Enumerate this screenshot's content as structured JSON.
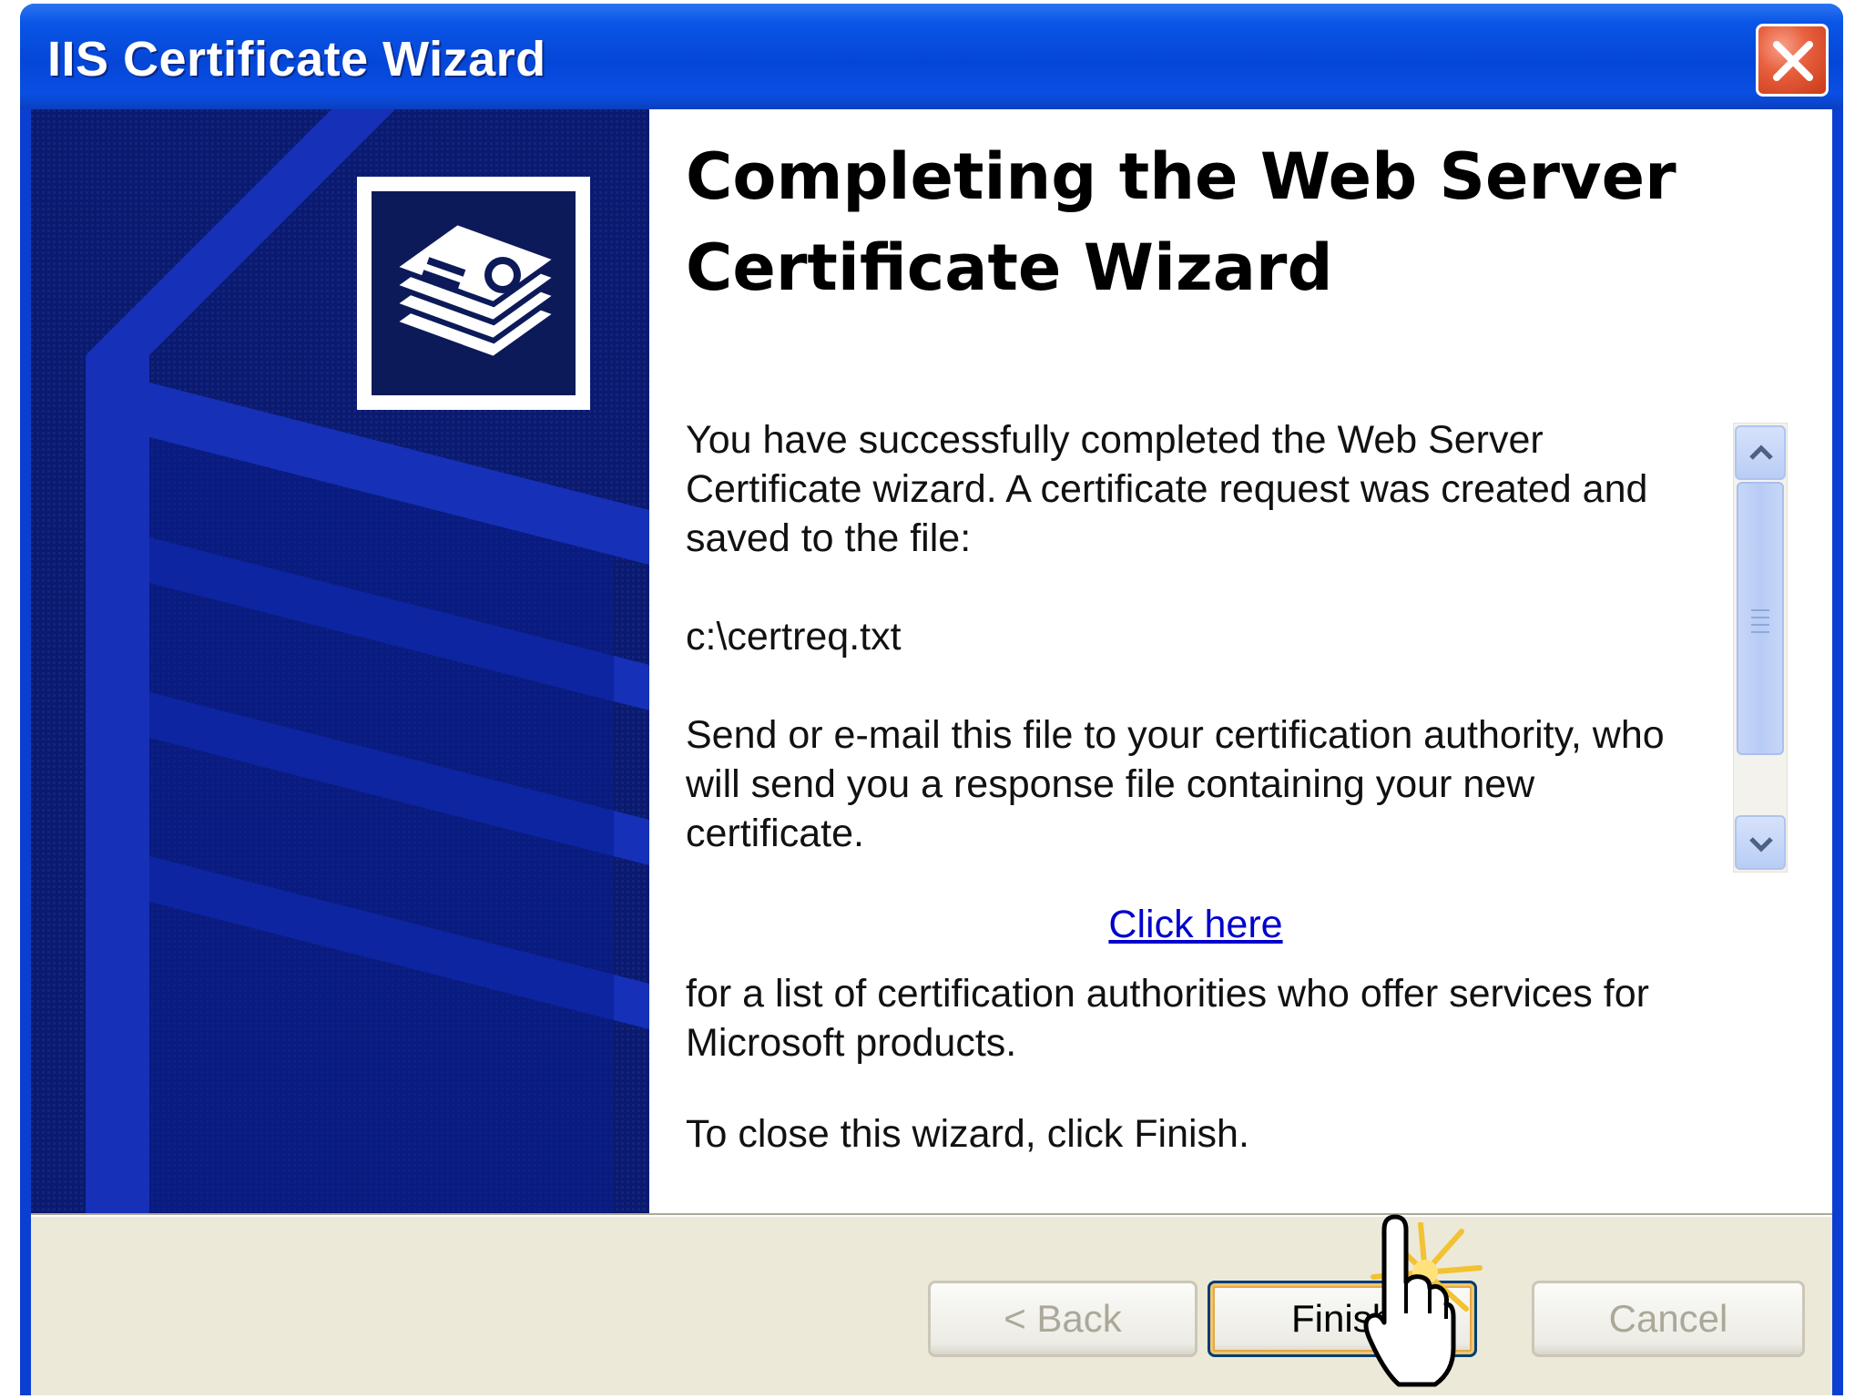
{
  "window": {
    "title": "IIS Certificate Wizard",
    "close_icon": "close-icon"
  },
  "page": {
    "heading": "Completing the Web Server Certificate Wizard",
    "paragraph1": "You have successfully completed the Web Server Certificate wizard. A certificate request was created and saved to the file:",
    "file_path": "c:\\certreq.txt",
    "paragraph2": "Send or e-mail this file to your certification authority, who will send you a response file containing your new certificate.",
    "link_text": "Click here",
    "paragraph3": "for a list of certification authorities who offer services for Microsoft products.",
    "paragraph4": "To close this wizard, click Finish."
  },
  "buttons": {
    "back_label": "< Back",
    "finish_label": "Finish",
    "cancel_label": "Cancel"
  },
  "colors": {
    "titlebar": "#0446d8",
    "left_panel": "#0b1a6e",
    "link": "#0000cc",
    "dialog_face": "#ece9d8"
  }
}
